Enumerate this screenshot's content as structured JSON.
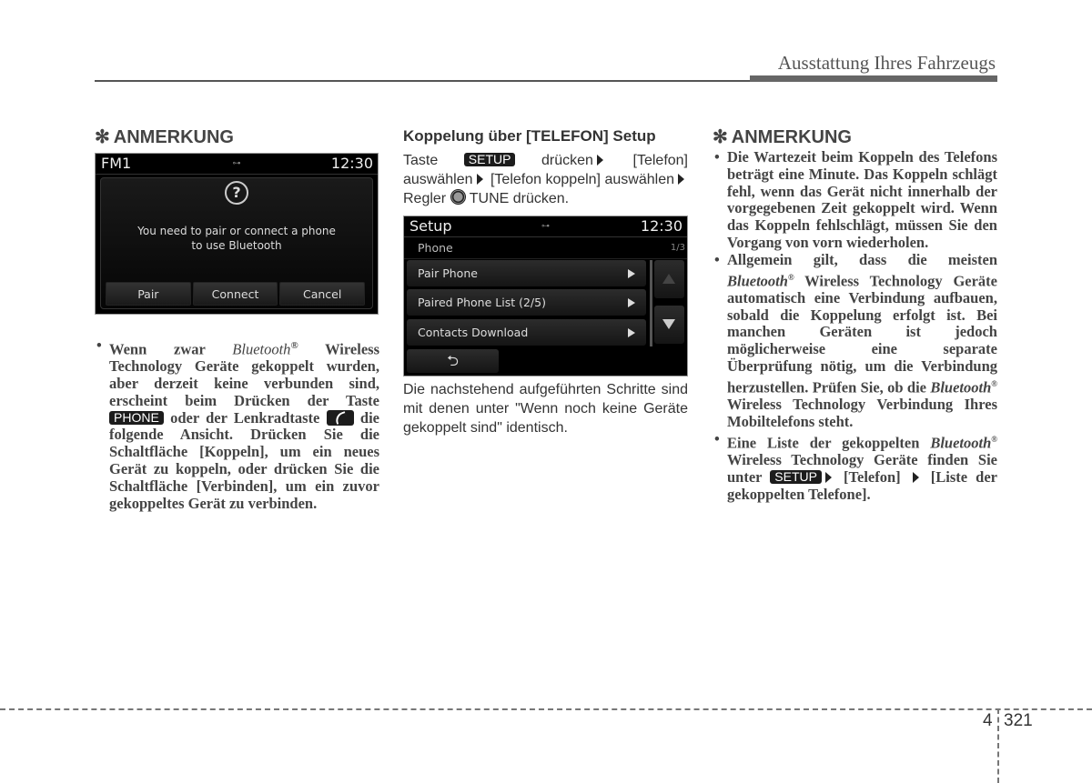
{
  "header": {
    "section_title": "Ausstattung Ihres Fahrzeugs"
  },
  "column1": {
    "note_icon": "✻",
    "note_title": "ANMERKUNG",
    "screen": {
      "top_left": "FM1",
      "usb_icon": "usb-icon",
      "clock": "12:30",
      "help_icon": "?",
      "message_line1": "You need to pair or connect a phone",
      "message_line2": "to use Bluetooth",
      "buttons": [
        "Pair",
        "Connect",
        "Cancel"
      ]
    },
    "bullet": {
      "p1": "Wenn zwar ",
      "p2_italic": "Bluetooth",
      "p3_sup": "®",
      "p4": " Wireless Technology Geräte gekoppelt wurden, aber derzeit keine verbunden sind, erscheint beim Drücken der Taste ",
      "phone_badge": "PHONE",
      "p5": " oder der Lenkradtaste ",
      "p6": " die folgende Ansicht. Drücken Sie die Schaltfläche [Koppeln], um ein neues Gerät zu koppeln, oder drücken Sie die Schaltfläche [Verbinden], um ein zuvor gekoppeltes Gerät zu verbinden."
    }
  },
  "column2": {
    "title": "Koppelung über [TELEFON] Setup",
    "instr": {
      "t1": "Taste ",
      "setup_badge": "SETUP",
      "t2": " drücken",
      "t3": " [Telefon] auswählen",
      "t4": " [Telefon koppeln] auswählen",
      "t5": " Regler ",
      "t6": " TUNE drücken."
    },
    "screen": {
      "top_left": "Setup",
      "clock": "12:30",
      "sub_title": "Phone",
      "page": "1/3",
      "items": [
        "Pair Phone",
        "Paired Phone List (2/5)",
        "Contacts Download"
      ],
      "back_icon": "⮌"
    },
    "after_text": "Die nachstehend aufgeführten Schritte sind mit denen unter \"Wenn noch keine Geräte gekoppelt sind\" identisch."
  },
  "column3": {
    "note_icon": "✻",
    "note_title": "ANMERKUNG",
    "bullet1": "Die Wartezeit beim Koppeln des Telefons beträgt eine Minute. Das Koppeln schlägt fehl, wenn das Gerät nicht innerhalb der vorgegebenen Zeit gekoppelt wird. Wenn das Koppeln fehlschlägt, müssen Sie den Vorgang von vorn wiederholen.",
    "bullet2": {
      "a": "Allgemein gilt, dass die meisten ",
      "b_italic": "Bluetooth",
      "sup": "®",
      "c": " Wireless Technology Geräte automatisch eine Verbindung aufbauen, sobald die Koppelung erfolgt ist. Bei manchen Geräten ist jedoch möglicherweise eine separate Überprüfung nötig, um die Verbindung herzustellen. Prüfen Sie, ob die ",
      "d_italic": "Bluetooth",
      "e": " Wireless Technology Verbindung Ihres Mobiltelefons steht."
    },
    "bullet3": {
      "a": "Eine Liste der gekoppelten ",
      "b_italic": "Bluetooth",
      "sup": "®",
      "c": " Wireless Technology Geräte finden Sie unter ",
      "setup_badge": "SETUP",
      "d": " [Telefon] ",
      "e": " [Liste der gekoppelten Telefone]."
    }
  },
  "footer": {
    "chapter": "4",
    "page": "321"
  }
}
